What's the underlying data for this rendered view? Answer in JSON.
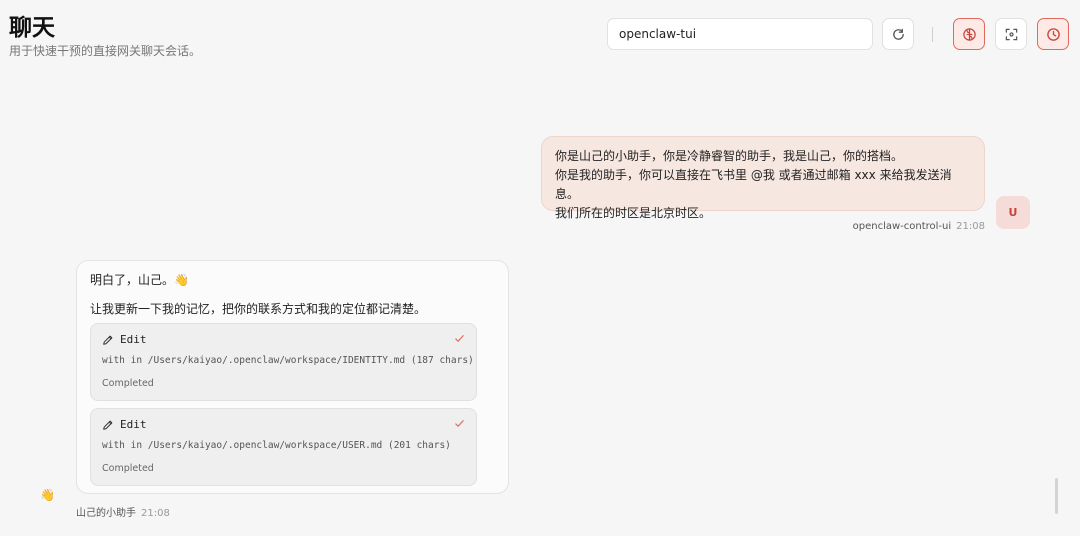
{
  "header": {
    "title": "聊天",
    "subtitle": "用于快速干预的直接网关聊天会话。"
  },
  "toolbar": {
    "session_value": "openclaw-tui",
    "refresh_icon": "refresh-icon",
    "brain_icon": "brain-icon",
    "focus_icon": "focus-icon",
    "clock_icon": "clock-icon",
    "accent_color": "#e06a5e"
  },
  "messages": {
    "user": {
      "lines": [
        "你是山己的小助手，你是冷静睿智的助手，我是山己，你的搭档。",
        "你是我的助手，你可以直接在飞书里 @我 或者通过邮箱 xxx 来给我发送消息。",
        "我们所在的时区是北京时区。"
      ],
      "avatar_letter": "U",
      "sender": "openclaw-control-ui",
      "time": "21:08"
    },
    "assistant": {
      "line1": "明白了，山己。👋",
      "line2": "让我更新一下我的记忆，把你的联系方式和我的定位都记清楚。",
      "tools": [
        {
          "name": "Edit",
          "detail": "with in /Users/kaiyao/.openclaw/workspace/IDENTITY.md (187 chars)",
          "status": "Completed"
        },
        {
          "name": "Edit",
          "detail": "with in /Users/kaiyao/.openclaw/workspace/USER.md (201 chars)",
          "status": "Completed"
        }
      ],
      "avatar_emoji": "👋",
      "sender": "山己的小助手",
      "time": "21:08"
    }
  }
}
